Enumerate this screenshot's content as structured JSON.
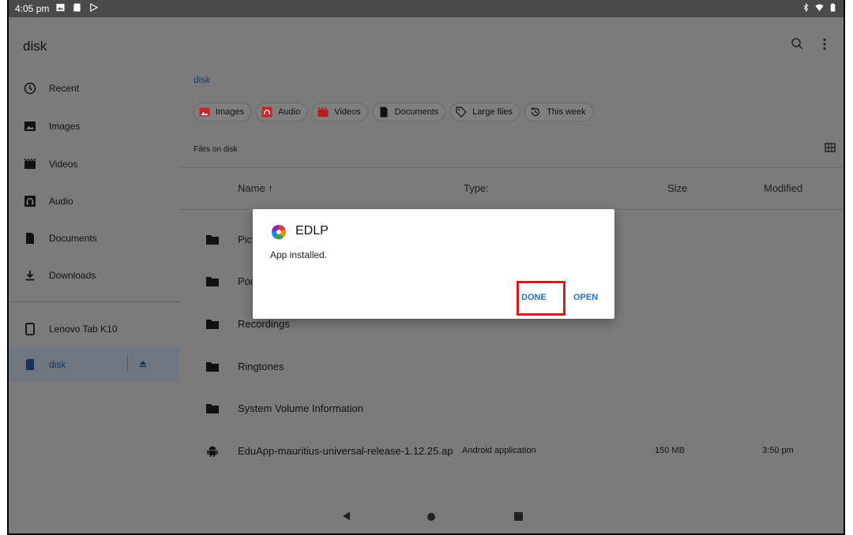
{
  "status_bar": {
    "time": "4:05 pm",
    "left_icons": [
      "image-icon",
      "sd-card-icon",
      "play-store-icon"
    ],
    "right_icons": [
      "bluetooth-icon",
      "wifi-icon",
      "battery-icon"
    ]
  },
  "app_bar": {
    "title": "disk",
    "icons": [
      "search-icon",
      "more-vert-icon"
    ]
  },
  "sidebar": {
    "items": [
      {
        "label": "Recent",
        "icon": "clock-icon"
      },
      {
        "label": "Images",
        "icon": "image-icon"
      },
      {
        "label": "Videos",
        "icon": "video-icon"
      },
      {
        "label": "Audio",
        "icon": "audio-icon"
      },
      {
        "label": "Documents",
        "icon": "document-icon"
      },
      {
        "label": "Downloads",
        "icon": "download-icon"
      }
    ],
    "devices": [
      {
        "label": "Lenovo Tab K10",
        "icon": "tablet-icon"
      },
      {
        "label": "disk",
        "icon": "sd-card-icon",
        "selected": true,
        "action_icon": "eject-icon"
      }
    ]
  },
  "main": {
    "breadcrumb": "disk",
    "chips": [
      {
        "label": "Images",
        "icon": "image-icon"
      },
      {
        "label": "Audio",
        "icon": "audio-icon"
      },
      {
        "label": "Videos",
        "icon": "video-icon"
      },
      {
        "label": "Documents",
        "icon": "document-icon"
      },
      {
        "label": "Large files",
        "icon": "tag-icon"
      },
      {
        "label": "This week",
        "icon": "history-icon"
      }
    ],
    "section_label": "Files on disk",
    "view_toggle_icon": "grid-view-icon",
    "columns": {
      "name": "Name ↑",
      "type": "Type:",
      "size": "Size",
      "modified": "Modified"
    },
    "rows": [
      {
        "name": "Pictu",
        "type": "",
        "size": "",
        "modified": "",
        "icon": "folder-icon"
      },
      {
        "name": "Podc",
        "type": "",
        "size": "",
        "modified": "",
        "icon": "folder-icon"
      },
      {
        "name": "Recordings",
        "type": "",
        "size": "",
        "modified": "",
        "icon": "folder-icon"
      },
      {
        "name": "Ringtones",
        "type": "",
        "size": "",
        "modified": "",
        "icon": "folder-icon"
      },
      {
        "name": "System Volume Information",
        "type": "",
        "size": "",
        "modified": "",
        "icon": "folder-icon"
      },
      {
        "name": "EduApp-mauritius-universal-release-1.12.25.ap",
        "type": "Android application",
        "size": "150 MB",
        "modified": "3:50 pm",
        "icon": "android-icon"
      }
    ]
  },
  "dialog": {
    "app_icon": "edlp-app-icon",
    "title": "EDLP",
    "message": "App installed.",
    "done_label": "DONE",
    "open_label": "OPEN"
  },
  "colors": {
    "accent": "#1a73c9",
    "highlight": "#e0161f",
    "scrim": "#7b7b7b"
  }
}
